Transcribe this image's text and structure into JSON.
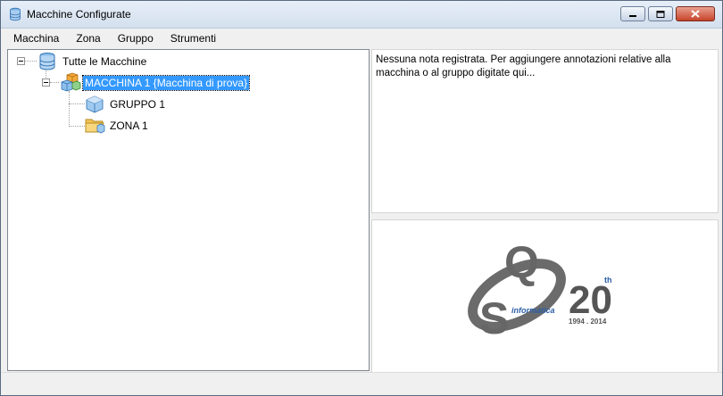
{
  "window": {
    "title": "Macchine Configurate",
    "title_icon": "database-icon"
  },
  "menu": {
    "items": [
      {
        "label": "Macchina"
      },
      {
        "label": "Zona"
      },
      {
        "label": "Gruppo"
      },
      {
        "label": "Strumenti"
      }
    ]
  },
  "tree": {
    "root": {
      "label": "Tutte le Macchine",
      "icon": "database-icon"
    },
    "machine": {
      "label": "MACCHINA 1 {Macchina di prova}",
      "icon": "machine-icon",
      "selected": true
    },
    "group": {
      "label": "GRUPPO 1",
      "icon": "cube-icon"
    },
    "zone": {
      "label": "ZONA 1",
      "icon": "folder-icon"
    }
  },
  "notes": {
    "text": "Nessuna nota registrata. Per aggiungere annotazioni relative alla macchina o al gruppo digitate qui..."
  },
  "logo": {
    "letter_q": "Q",
    "letter_s": "S",
    "brand": "informatica",
    "anniversary": "20",
    "suffix": "th",
    "years": "1994 . 2014"
  },
  "colors": {
    "selection": "#3399ff",
    "logo_gray": "#6b6b6b",
    "logo_blue": "#2b5fa8",
    "close_button": "#c7432a"
  }
}
